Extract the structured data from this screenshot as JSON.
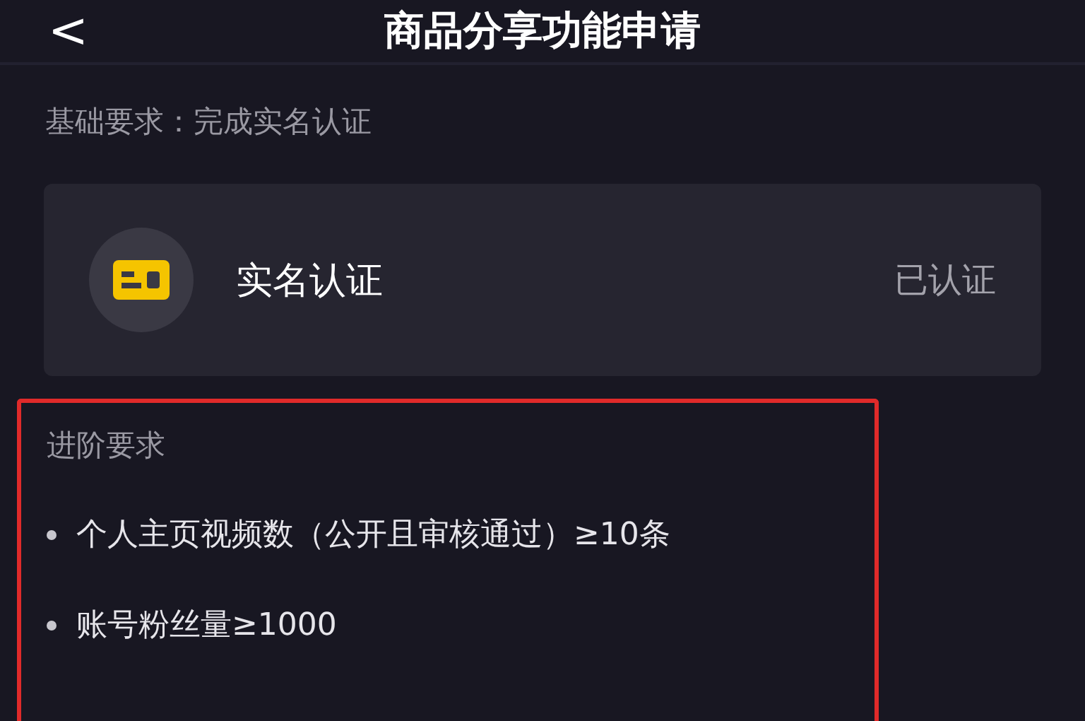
{
  "header": {
    "back": "<",
    "title": "商品分享功能申请"
  },
  "basic": {
    "label": "基础要求：完成实名认证"
  },
  "card": {
    "title": "实名认证",
    "status": "已认证",
    "verified": true
  },
  "advanced": {
    "highlighted": true,
    "label": "进阶要求",
    "items": [
      {
        "text": "个人主页视频数（公开且审核通过）≥10条"
      },
      {
        "text": "账号粉丝量≥1000"
      }
    ]
  }
}
